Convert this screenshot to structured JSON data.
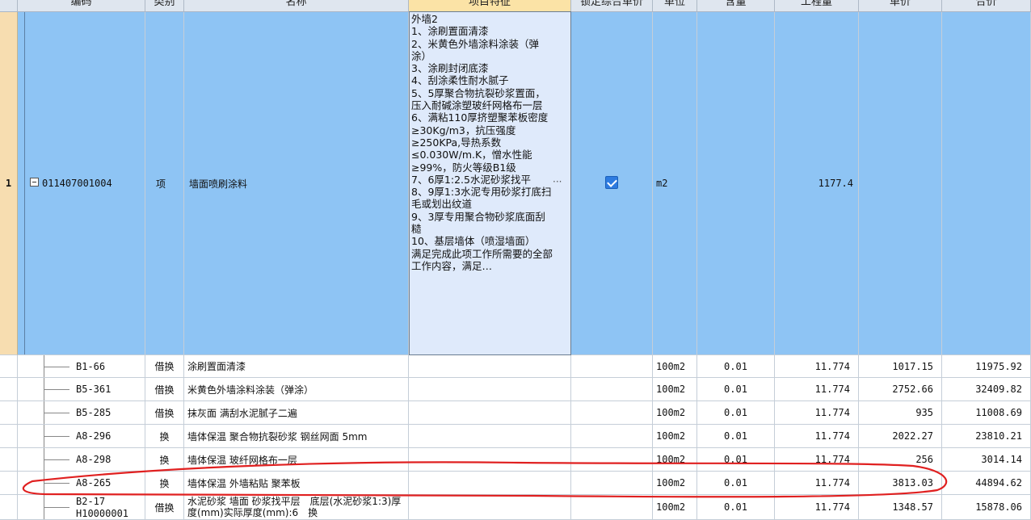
{
  "header": {
    "columns": [
      "",
      "编码",
      "类别",
      "名称",
      "项目特征",
      "锁定综合单价",
      "单位",
      "含量",
      "工程量",
      "单价",
      "合价"
    ]
  },
  "main_row": {
    "row_number": "1",
    "code": "011407001004",
    "category": "项",
    "name": "墙面喷刷涂料",
    "feature": "外墙2\n1、涂刷置面清漆\n2、米黄色外墙涂料涂装（弹涂）\n3、涂刷封闭底漆\n4、刮涂柔性耐水腻子\n5、5厚聚合物抗裂砂浆置面，压入耐碱涂塑玻纤网格布一层\n6、满粘110厚挤塑聚苯板密度≥30Kg/m3，抗压强度≥250KPa,导热系数≤0.030W/m.K，憎水性能≥99%，防火等级B1级\n7、6厚1:2.5水泥砂浆找平\n8、9厚1:3水泥专用砂浆打底扫毛或划出纹道\n9、3厚专用聚合物砂浆底面刮糙\n10、基层墙体（喷湿墙面）\n满足完成此项工作所需要的全部工作内容，满足…",
    "feature_more": "···",
    "locked": true,
    "unit": "m2",
    "quantity": "1177.4"
  },
  "sub_rows": [
    {
      "code": "B1-66",
      "category": "借换",
      "name": "涂刷置面清漆",
      "unit": "100m2",
      "content": "0.01",
      "quantity": "11.774",
      "price": "1017.15",
      "total": "11975.92"
    },
    {
      "code": "B5-361",
      "category": "借换",
      "name": "米黄色外墙涂料涂装（弹涂）",
      "unit": "100m2",
      "content": "0.01",
      "quantity": "11.774",
      "price": "2752.66",
      "total": "32409.82"
    },
    {
      "code": "B5-285",
      "category": "借换",
      "name": "抹灰面 满刮水泥腻子二遍",
      "unit": "100m2",
      "content": "0.01",
      "quantity": "11.774",
      "price": "935",
      "total": "11008.69"
    },
    {
      "code": "A8-296",
      "category": "换",
      "name": "墙体保温 聚合物抗裂砂浆 钢丝网面 5mm",
      "unit": "100m2",
      "content": "0.01",
      "quantity": "11.774",
      "price": "2022.27",
      "total": "23810.21"
    },
    {
      "code": "A8-298",
      "category": "换",
      "name": "墙体保温 玻纤网格布一层",
      "unit": "100m2",
      "content": "0.01",
      "quantity": "11.774",
      "price": "256",
      "total": "3014.14"
    },
    {
      "code": "A8-265",
      "category": "换",
      "name": "墙体保温 外墙粘贴 聚苯板",
      "unit": "100m2",
      "content": "0.01",
      "quantity": "11.774",
      "price": "3813.03",
      "total": "44894.62"
    },
    {
      "code": "B2-17",
      "code2": "H10000001",
      "category": "借换",
      "name": "水泥砂浆 墙面 砂浆找平层　底层(水泥砂浆1:3)厚度(mm)实际厚度(mm):6　换",
      "unit": "100m2",
      "content": "0.01",
      "quantity": "11.774",
      "price": "1348.57",
      "total": "15878.06"
    }
  ],
  "colors": {
    "selected_row": "#8ec4f4",
    "row_number_bg": "#f7ddb0",
    "annotation": "#e02020",
    "checkbox": "#2d7be0"
  }
}
